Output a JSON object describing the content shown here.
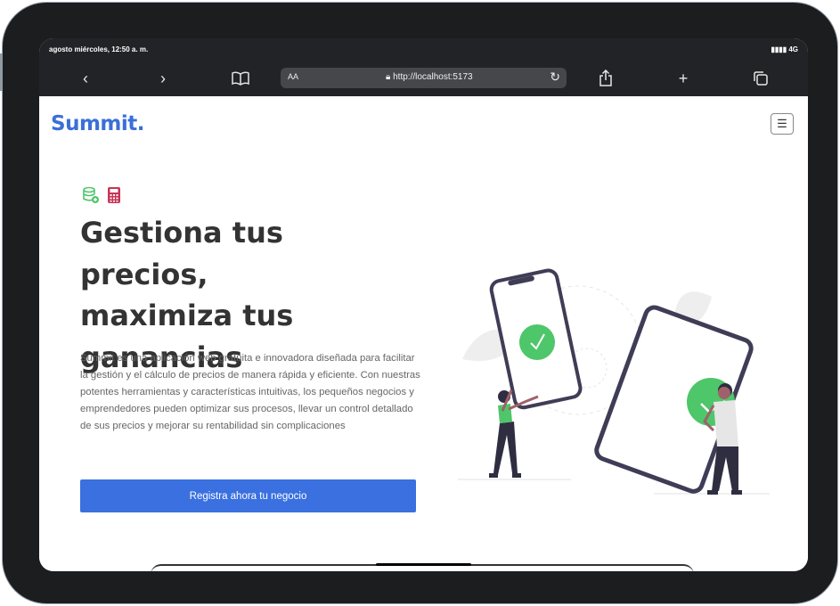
{
  "status_bar": {
    "time": "agosto miércoles, 12:50 a. m.",
    "network": "4G"
  },
  "browser": {
    "text_size_label": "AA",
    "url": "http://localhost:5173"
  },
  "site": {
    "logo": "Summit.",
    "menu_icon": "hamburger-icon",
    "feature_icons": [
      "database-add-icon",
      "calculator-icon"
    ],
    "headline_lines": [
      "Gestiona tus precios,",
      "maximiza tus",
      "ganancias"
    ],
    "description": "Summit es una aplicación web gratuita e innovadora diseñada para facilitar la gestión y el cálculo de precios de manera rápida y eficiente. Con nuestras potentes herramientas y características intuitivas, los pequeños negocios y emprendedores pueden optimizar sus procesos, llevar un control detallado de sus precios y mejorar su rentabilidad sin complicaciones",
    "cta_label": "Registra ahora tu negocio"
  },
  "colors": {
    "brand": "#3b6fd8",
    "button": "#3a70e0",
    "check_green": "#4ec66a",
    "calculator_red": "#c73456",
    "device_dark": "#3f3d56"
  }
}
